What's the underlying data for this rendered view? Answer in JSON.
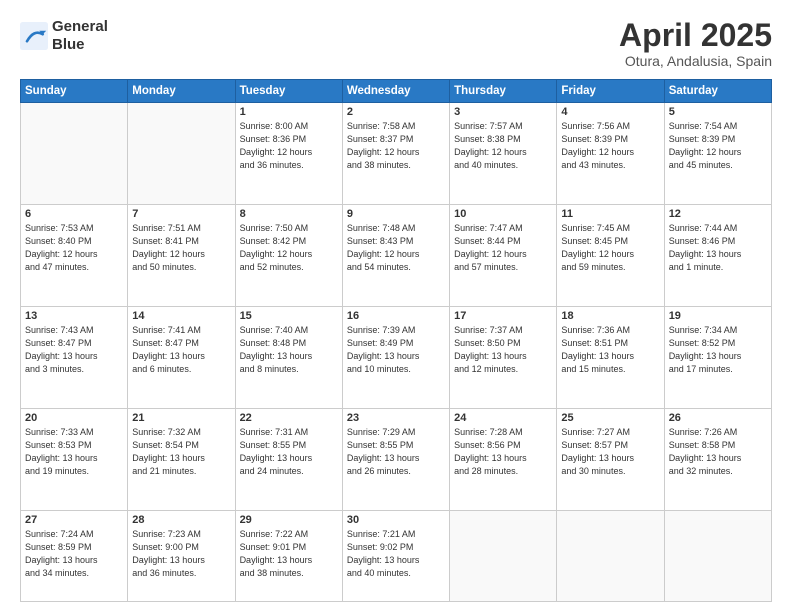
{
  "header": {
    "logo_line1": "General",
    "logo_line2": "Blue",
    "main_title": "April 2025",
    "subtitle": "Otura, Andalusia, Spain"
  },
  "weekdays": [
    "Sunday",
    "Monday",
    "Tuesday",
    "Wednesday",
    "Thursday",
    "Friday",
    "Saturday"
  ],
  "weeks": [
    [
      {
        "day": "",
        "info": ""
      },
      {
        "day": "",
        "info": ""
      },
      {
        "day": "1",
        "info": "Sunrise: 8:00 AM\nSunset: 8:36 PM\nDaylight: 12 hours\nand 36 minutes."
      },
      {
        "day": "2",
        "info": "Sunrise: 7:58 AM\nSunset: 8:37 PM\nDaylight: 12 hours\nand 38 minutes."
      },
      {
        "day": "3",
        "info": "Sunrise: 7:57 AM\nSunset: 8:38 PM\nDaylight: 12 hours\nand 40 minutes."
      },
      {
        "day": "4",
        "info": "Sunrise: 7:56 AM\nSunset: 8:39 PM\nDaylight: 12 hours\nand 43 minutes."
      },
      {
        "day": "5",
        "info": "Sunrise: 7:54 AM\nSunset: 8:39 PM\nDaylight: 12 hours\nand 45 minutes."
      }
    ],
    [
      {
        "day": "6",
        "info": "Sunrise: 7:53 AM\nSunset: 8:40 PM\nDaylight: 12 hours\nand 47 minutes."
      },
      {
        "day": "7",
        "info": "Sunrise: 7:51 AM\nSunset: 8:41 PM\nDaylight: 12 hours\nand 50 minutes."
      },
      {
        "day": "8",
        "info": "Sunrise: 7:50 AM\nSunset: 8:42 PM\nDaylight: 12 hours\nand 52 minutes."
      },
      {
        "day": "9",
        "info": "Sunrise: 7:48 AM\nSunset: 8:43 PM\nDaylight: 12 hours\nand 54 minutes."
      },
      {
        "day": "10",
        "info": "Sunrise: 7:47 AM\nSunset: 8:44 PM\nDaylight: 12 hours\nand 57 minutes."
      },
      {
        "day": "11",
        "info": "Sunrise: 7:45 AM\nSunset: 8:45 PM\nDaylight: 12 hours\nand 59 minutes."
      },
      {
        "day": "12",
        "info": "Sunrise: 7:44 AM\nSunset: 8:46 PM\nDaylight: 13 hours\nand 1 minute."
      }
    ],
    [
      {
        "day": "13",
        "info": "Sunrise: 7:43 AM\nSunset: 8:47 PM\nDaylight: 13 hours\nand 3 minutes."
      },
      {
        "day": "14",
        "info": "Sunrise: 7:41 AM\nSunset: 8:47 PM\nDaylight: 13 hours\nand 6 minutes."
      },
      {
        "day": "15",
        "info": "Sunrise: 7:40 AM\nSunset: 8:48 PM\nDaylight: 13 hours\nand 8 minutes."
      },
      {
        "day": "16",
        "info": "Sunrise: 7:39 AM\nSunset: 8:49 PM\nDaylight: 13 hours\nand 10 minutes."
      },
      {
        "day": "17",
        "info": "Sunrise: 7:37 AM\nSunset: 8:50 PM\nDaylight: 13 hours\nand 12 minutes."
      },
      {
        "day": "18",
        "info": "Sunrise: 7:36 AM\nSunset: 8:51 PM\nDaylight: 13 hours\nand 15 minutes."
      },
      {
        "day": "19",
        "info": "Sunrise: 7:34 AM\nSunset: 8:52 PM\nDaylight: 13 hours\nand 17 minutes."
      }
    ],
    [
      {
        "day": "20",
        "info": "Sunrise: 7:33 AM\nSunset: 8:53 PM\nDaylight: 13 hours\nand 19 minutes."
      },
      {
        "day": "21",
        "info": "Sunrise: 7:32 AM\nSunset: 8:54 PM\nDaylight: 13 hours\nand 21 minutes."
      },
      {
        "day": "22",
        "info": "Sunrise: 7:31 AM\nSunset: 8:55 PM\nDaylight: 13 hours\nand 24 minutes."
      },
      {
        "day": "23",
        "info": "Sunrise: 7:29 AM\nSunset: 8:55 PM\nDaylight: 13 hours\nand 26 minutes."
      },
      {
        "day": "24",
        "info": "Sunrise: 7:28 AM\nSunset: 8:56 PM\nDaylight: 13 hours\nand 28 minutes."
      },
      {
        "day": "25",
        "info": "Sunrise: 7:27 AM\nSunset: 8:57 PM\nDaylight: 13 hours\nand 30 minutes."
      },
      {
        "day": "26",
        "info": "Sunrise: 7:26 AM\nSunset: 8:58 PM\nDaylight: 13 hours\nand 32 minutes."
      }
    ],
    [
      {
        "day": "27",
        "info": "Sunrise: 7:24 AM\nSunset: 8:59 PM\nDaylight: 13 hours\nand 34 minutes."
      },
      {
        "day": "28",
        "info": "Sunrise: 7:23 AM\nSunset: 9:00 PM\nDaylight: 13 hours\nand 36 minutes."
      },
      {
        "day": "29",
        "info": "Sunrise: 7:22 AM\nSunset: 9:01 PM\nDaylight: 13 hours\nand 38 minutes."
      },
      {
        "day": "30",
        "info": "Sunrise: 7:21 AM\nSunset: 9:02 PM\nDaylight: 13 hours\nand 40 minutes."
      },
      {
        "day": "",
        "info": ""
      },
      {
        "day": "",
        "info": ""
      },
      {
        "day": "",
        "info": ""
      }
    ]
  ]
}
